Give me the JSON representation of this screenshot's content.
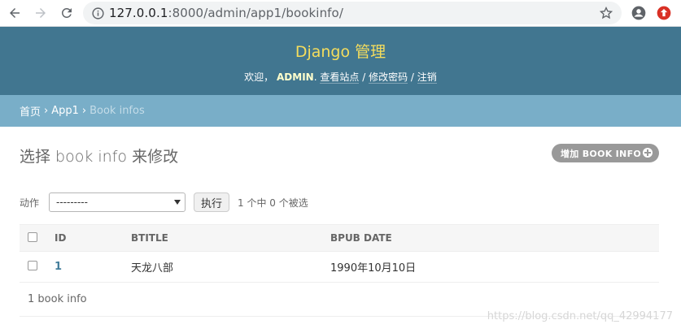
{
  "browser": {
    "url_host": "127.0.0.1",
    "url_rest": ":8000/admin/app1/bookinfo/"
  },
  "header": {
    "branding": "Django 管理",
    "welcome": "欢迎，",
    "username": "ADMIN",
    "view_site": "查看站点",
    "change_password": "修改密码",
    "logout": "注销",
    "separator": "/"
  },
  "breadcrumbs": {
    "home": "首页",
    "app": "App1",
    "current": "Book infos",
    "sep": "›"
  },
  "content": {
    "title": "选择 book info 来修改",
    "add_button": "增加 BOOK INFO"
  },
  "actions": {
    "label": "动作",
    "select_value": "---------",
    "go_button": "执行",
    "selection_count": "1 个中 0 个被选"
  },
  "table": {
    "headers": [
      "ID",
      "BTITLE",
      "BPUB DATE"
    ],
    "rows": [
      {
        "id": "1",
        "btitle": "天龙八部",
        "bpub_date": "1990年10月10日"
      }
    ]
  },
  "paginator": "1 book info",
  "watermark": "https://blog.csdn.net/qq_42994177"
}
